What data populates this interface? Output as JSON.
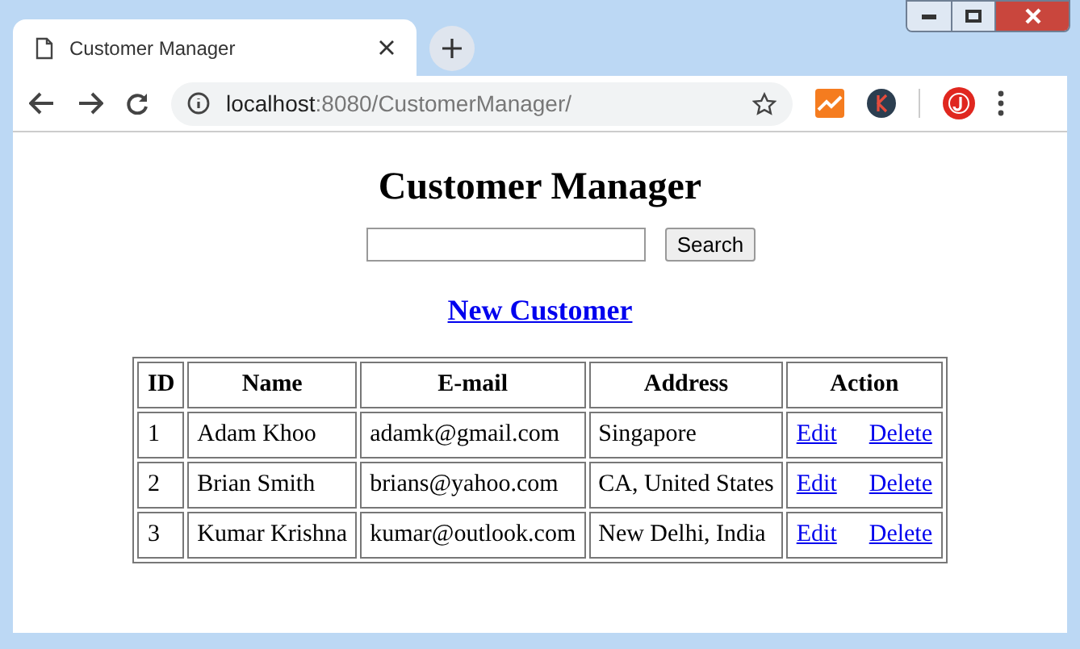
{
  "tab": {
    "title": "Customer Manager"
  },
  "address_bar": {
    "host": "localhost",
    "path": ":8080/CustomerManager/"
  },
  "page": {
    "heading": "Customer Manager",
    "search_button": "Search",
    "new_link": "New Customer"
  },
  "table": {
    "columns": [
      "ID",
      "Name",
      "E-mail",
      "Address",
      "Action"
    ],
    "rows": [
      {
        "id": "1",
        "name": "Adam Khoo",
        "email": "adamk@gmail.com",
        "address": "Singapore",
        "actions": [
          "Edit",
          "Delete"
        ]
      },
      {
        "id": "2",
        "name": "Brian Smith",
        "email": "brians@yahoo.com",
        "address": "CA, United States",
        "actions": [
          "Edit",
          "Delete"
        ]
      },
      {
        "id": "3",
        "name": "Kumar Krishna",
        "email": "kumar@outlook.com",
        "address": "New Delhi, India",
        "actions": [
          "Edit",
          "Delete"
        ]
      }
    ]
  }
}
